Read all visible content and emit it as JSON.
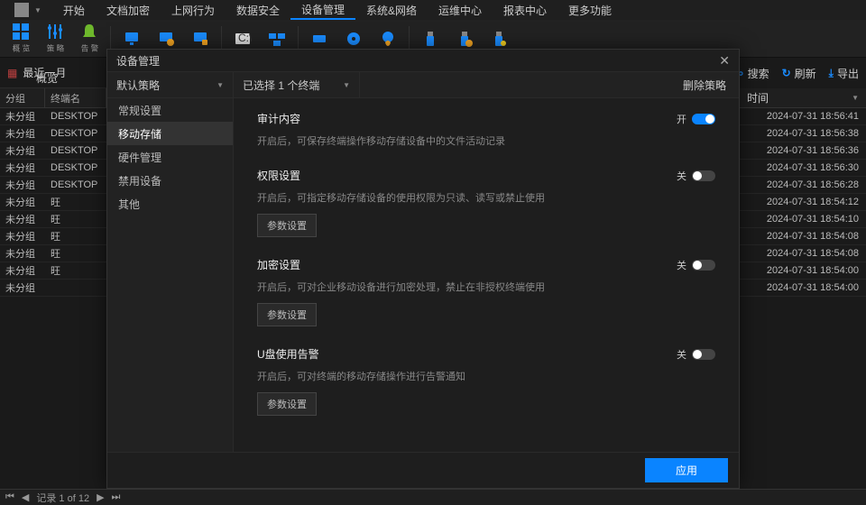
{
  "menu": {
    "items": [
      "开始",
      "文档加密",
      "上网行为",
      "数据安全",
      "设备管理",
      "系统&网络",
      "运维中心",
      "报表中心",
      "更多功能"
    ],
    "active": 4
  },
  "toolbar": {
    "items": [
      {
        "name": "overview",
        "label": "概 览"
      },
      {
        "name": "policy",
        "label": "策 略"
      },
      {
        "name": "alert",
        "label": "告 警"
      }
    ]
  },
  "crumb": "概览",
  "date_range": "最近一月",
  "left_cols": {
    "group": "分组",
    "name": "终端名"
  },
  "rows": [
    {
      "group": "未分组",
      "name": "DESKTOP"
    },
    {
      "group": "未分组",
      "name": "DESKTOP"
    },
    {
      "group": "未分组",
      "name": "DESKTOP"
    },
    {
      "group": "未分组",
      "name": "DESKTOP"
    },
    {
      "group": "未分组",
      "name": "DESKTOP"
    },
    {
      "group": "未分组",
      "name": "旺"
    },
    {
      "group": "未分组",
      "name": "旺"
    },
    {
      "group": "未分组",
      "name": "旺"
    },
    {
      "group": "未分组",
      "name": "旺"
    },
    {
      "group": "未分组",
      "name": "旺"
    },
    {
      "group": "未分组",
      "name": ""
    }
  ],
  "right": {
    "actions": {
      "search": "搜索",
      "refresh": "刷新",
      "export": "导出"
    },
    "col": "时间",
    "times": [
      "2024-07-31 18:56:41",
      "2024-07-31 18:56:38",
      "2024-07-31 18:56:36",
      "2024-07-31 18:56:30",
      "2024-07-31 18:56:28",
      "2024-07-31 18:54:12",
      "2024-07-31 18:54:10",
      "2024-07-31 18:54:08",
      "2024-07-31 18:54:08",
      "2024-07-31 18:54:00",
      "2024-07-31 18:54:00"
    ]
  },
  "modal": {
    "title": "设备管理",
    "policy_dd": "默认策略",
    "target_dd": "已选择 1 个终端",
    "delete": "删除策略",
    "sidebar": [
      "常规设置",
      "移动存储",
      "硬件管理",
      "禁用设备",
      "其他"
    ],
    "sidebar_sel": 1,
    "sections": [
      {
        "title": "审计内容",
        "desc": "开启后，可保存终端操作移动存储设备中的文件活动记录",
        "on": true,
        "state": "开",
        "btn": null
      },
      {
        "title": "权限设置",
        "desc": "开启后，可指定移动存储设备的使用权限为只读、读写或禁止使用",
        "on": false,
        "state": "关",
        "btn": "参数设置"
      },
      {
        "title": "加密设置",
        "desc": "开启后，可对企业移动设备进行加密处理，禁止在非授权终端使用",
        "on": false,
        "state": "关",
        "btn": "参数设置"
      },
      {
        "title": "U盘使用告警",
        "desc": "开启后，可对终端的移动存储操作进行告警通知",
        "on": false,
        "state": "关",
        "btn": "参数设置"
      }
    ],
    "apply": "应用"
  },
  "status": {
    "record": "记录 1 of 12"
  }
}
